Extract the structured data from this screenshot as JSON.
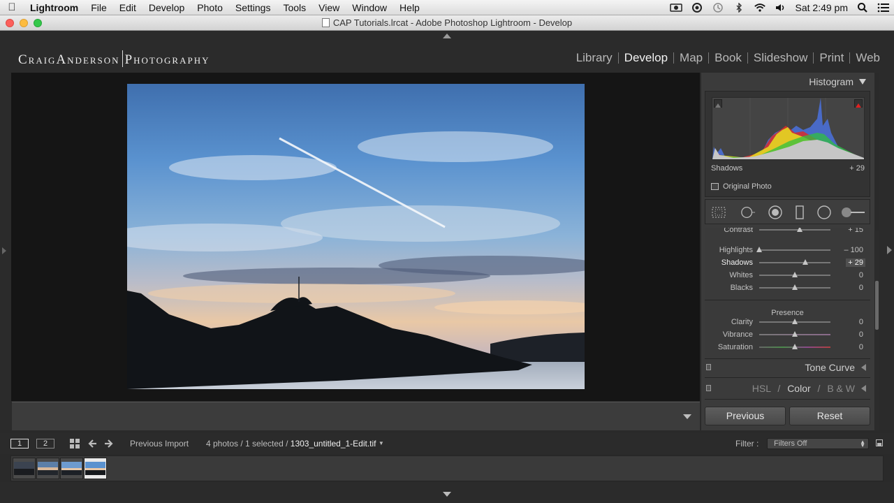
{
  "menubar": {
    "items": [
      "Lightroom",
      "File",
      "Edit",
      "Develop",
      "Photo",
      "Settings",
      "Tools",
      "View",
      "Window",
      "Help"
    ],
    "clock": "Sat 2:49 pm"
  },
  "window": {
    "title": "CAP Tutorials.lrcat - Adobe Photoshop Lightroom - Develop"
  },
  "identity_plate": {
    "left": "CraigAnderson",
    "right": "Photography"
  },
  "modules": [
    "Library",
    "Develop",
    "Map",
    "Book",
    "Slideshow",
    "Print",
    "Web"
  ],
  "active_module": "Develop",
  "histogram": {
    "title": "Histogram",
    "readout_label": "Shadows",
    "readout_value": "+ 29",
    "original_photo_label": "Original Photo"
  },
  "basic": {
    "partial_label": "Contrast",
    "partial_value": "+ 15",
    "partial_fraction": 0.57,
    "tone_sliders": [
      {
        "label": "Highlights",
        "value": "– 100",
        "fraction": 0.0,
        "active": false
      },
      {
        "label": "Shadows",
        "value": "+ 29",
        "fraction": 0.645,
        "active": true
      },
      {
        "label": "Whites",
        "value": "0",
        "fraction": 0.5,
        "active": false
      },
      {
        "label": "Blacks",
        "value": "0",
        "fraction": 0.5,
        "active": false
      }
    ],
    "presence_label": "Presence",
    "presence_sliders": [
      {
        "label": "Clarity",
        "value": "0",
        "fraction": 0.5
      },
      {
        "label": "Vibrance",
        "value": "0",
        "fraction": 0.5
      },
      {
        "label": "Saturation",
        "value": "0",
        "fraction": 0.5
      }
    ]
  },
  "panels": {
    "tone_curve": "Tone Curve",
    "hsl": "HSL",
    "color": "Color",
    "bw": "B & W",
    "slash": "/"
  },
  "buttons": {
    "previous": "Previous",
    "reset": "Reset"
  },
  "filmstrip_bar": {
    "monitor1": "1",
    "monitor2": "2",
    "source": "Previous Import",
    "count": "4 photos / 1 selected /",
    "filename": "1303_untitled_1-Edit.tif",
    "filter_label": "Filter :",
    "filter_value": "Filters Off"
  },
  "colors": {
    "background": "#2b2b2b",
    "panel": "#3b3b3b",
    "accent_text": "#f2f2f2"
  }
}
